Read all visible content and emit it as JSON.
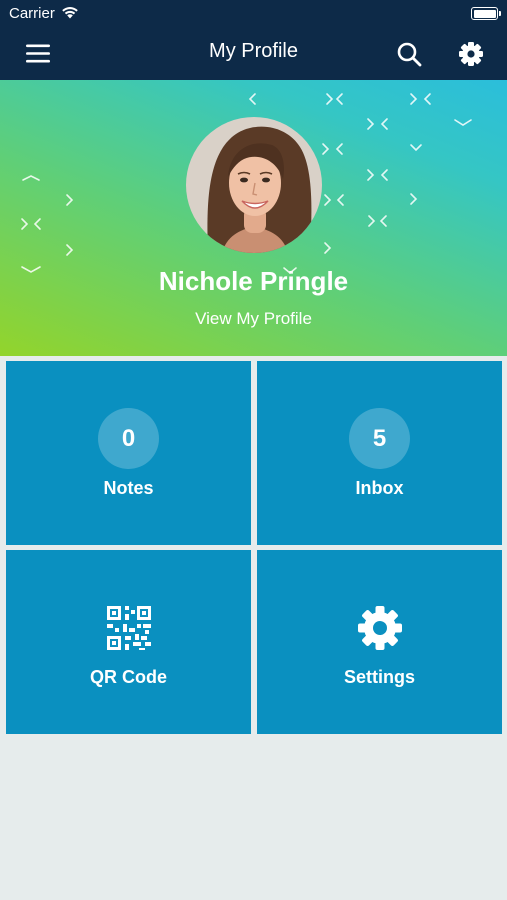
{
  "status_bar": {
    "carrier": "Carrier",
    "icons": [
      "wifi-icon",
      "battery-icon"
    ]
  },
  "nav": {
    "title": "My Profile",
    "left_icon": "menu-icon",
    "right_icons": [
      "search-icon",
      "gear-icon"
    ]
  },
  "profile": {
    "name": "Nichole Pringle",
    "view_link": "View My Profile"
  },
  "tiles": [
    {
      "label": "Notes",
      "count": "0"
    },
    {
      "label": "Inbox",
      "count": "5"
    },
    {
      "label": "QR Code",
      "icon": "qr-code-icon"
    },
    {
      "label": "Settings",
      "icon": "gear-icon"
    }
  ],
  "colors": {
    "nav_background": "#0d2a48",
    "tile_background": "#0a90c0",
    "page_background": "#e6ecec",
    "hero_gradient": [
      "#93d42b",
      "#5fcf78",
      "#35c6c4",
      "#2bbedb"
    ]
  }
}
